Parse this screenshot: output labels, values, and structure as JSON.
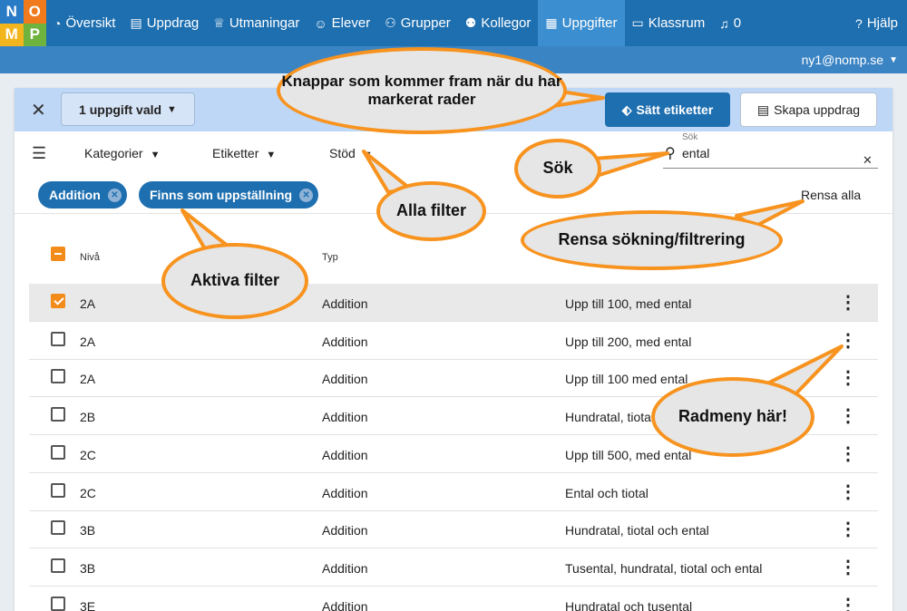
{
  "logo": {
    "letters": [
      "N",
      "O",
      "M",
      "P"
    ]
  },
  "nav": {
    "items": [
      {
        "label": "Översikt",
        "icon": "gauge-icon",
        "glyph": "◔"
      },
      {
        "label": "Uppdrag",
        "icon": "document-icon",
        "glyph": "▤"
      },
      {
        "label": "Utmaningar",
        "icon": "trophy-icon",
        "glyph": "♕"
      },
      {
        "label": "Elever",
        "icon": "user-icon",
        "glyph": "☺"
      },
      {
        "label": "Grupper",
        "icon": "users-icon",
        "glyph": "⚇"
      },
      {
        "label": "Kollegor",
        "icon": "colleagues-icon",
        "glyph": "⚉"
      },
      {
        "label": "Uppgifter",
        "icon": "table-icon",
        "glyph": "▦"
      },
      {
        "label": "Klassrum",
        "icon": "classroom-icon",
        "glyph": "▭"
      }
    ],
    "notifications": {
      "glyph": "♫",
      "count": "0"
    },
    "help": {
      "label": "Hjälp",
      "glyph": "?"
    }
  },
  "account": {
    "email": "ny1@nomp.se"
  },
  "selection": {
    "count_label": "1 uppgift vald",
    "set_tags_label": "Sätt etiketter",
    "create_label": "Skapa uppdrag"
  },
  "filters": {
    "dropdowns": [
      "Kategorier",
      "Etiketter",
      "Stöd"
    ]
  },
  "search": {
    "label": "Sök",
    "value": "ental"
  },
  "active_filters": [
    "Addition",
    "Finns som uppställning"
  ],
  "clear_all": "Rensa alla",
  "table": {
    "headers": {
      "level": "Nivå",
      "type": "Typ"
    },
    "rows": [
      {
        "level": "2A",
        "type": "Addition",
        "desc": "Upp till 100, med ental",
        "checked": true
      },
      {
        "level": "2A",
        "type": "Addition",
        "desc": "Upp till 200, med ental",
        "checked": false
      },
      {
        "level": "2A",
        "type": "Addition",
        "desc": "Upp till 100 med ental",
        "checked": false
      },
      {
        "level": "2B",
        "type": "Addition",
        "desc": "Hundratal, tiotal",
        "checked": false
      },
      {
        "level": "2C",
        "type": "Addition",
        "desc": "Upp till 500, med ental",
        "checked": false
      },
      {
        "level": "2C",
        "type": "Addition",
        "desc": "Ental och tiotal",
        "checked": false
      },
      {
        "level": "3B",
        "type": "Addition",
        "desc": "Hundratal, tiotal och ental",
        "checked": false
      },
      {
        "level": "3B",
        "type": "Addition",
        "desc": "Tusental, hundratal, tiotal och ental",
        "checked": false
      },
      {
        "level": "3E",
        "type": "Addition",
        "desc": "Hundratal och tusental",
        "checked": false
      }
    ]
  },
  "callouts": {
    "buttons": "Knappar som kommer fram när du har markerat rader",
    "search": "Sök",
    "all_filters": "Alla filter",
    "clear": "Rensa sökning/filtrering",
    "active_filters": "Aktiva filter",
    "row_menu": "Radmeny här!"
  },
  "colors": {
    "primary": "#1e6fb0",
    "accent": "#f7931e",
    "selection_bar": "#bed7f7"
  }
}
